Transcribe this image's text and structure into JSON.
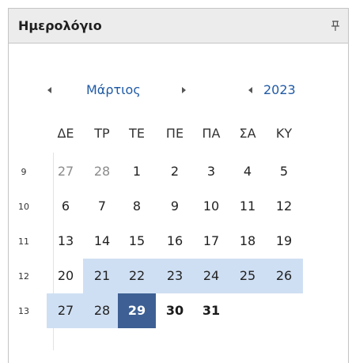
{
  "panel": {
    "title": "Ημερολόγιο"
  },
  "calendar": {
    "month": "Μάρτιος",
    "year": "2023",
    "weekdays": [
      "ΔΕ",
      "ΤΡ",
      "ΤΕ",
      "ΠΕ",
      "ΠΑ",
      "ΣΑ",
      "ΚΥ"
    ],
    "week_numbers": [
      "9",
      "10",
      "11",
      "12",
      "13"
    ],
    "weeks": [
      [
        "27",
        "28",
        "1",
        "2",
        "3",
        "4",
        "5"
      ],
      [
        "6",
        "7",
        "8",
        "9",
        "10",
        "11",
        "12"
      ],
      [
        "13",
        "14",
        "15",
        "16",
        "17",
        "18",
        "19"
      ],
      [
        "20",
        "21",
        "22",
        "23",
        "24",
        "25",
        "26"
      ],
      [
        "27",
        "28",
        "29",
        "30",
        "31",
        "",
        ""
      ]
    ],
    "selected_day": "29",
    "highlight_color": "#cfdff3",
    "selected_color": "#3d5f93",
    "link_color": "#1f5aa6"
  },
  "icons": {
    "pin": "pin-icon",
    "prev_month": "triangle-left-icon",
    "next_month": "triangle-right-icon",
    "prev_year": "triangle-left-icon"
  }
}
